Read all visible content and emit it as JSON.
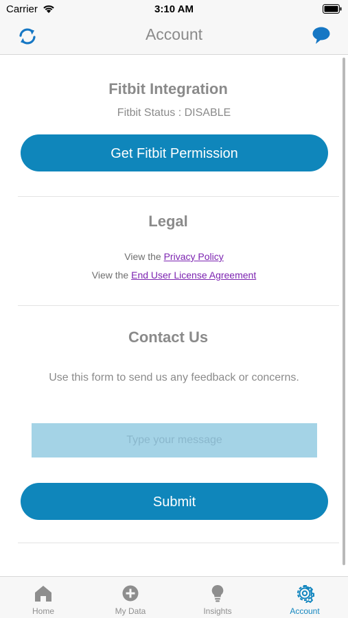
{
  "status_bar": {
    "carrier": "Carrier",
    "time": "3:10 AM"
  },
  "nav": {
    "title": "Account",
    "left_icon": "refresh-icon",
    "right_icon": "chat-bubble-icon"
  },
  "fitbit": {
    "title": "Fitbit Integration",
    "status": "Fitbit Status : DISABLE",
    "button_label": "Get Fitbit Permission"
  },
  "legal": {
    "title": "Legal",
    "line1_prefix": "View the ",
    "privacy_link": "Privacy Policy",
    "line2_prefix": "View the ",
    "eula_link": "End User License Agreement"
  },
  "contact": {
    "title": "Contact Us",
    "description": "Use this form to send  us any feedback or concerns.",
    "placeholder": "Type your message",
    "submit_label": "Submit"
  },
  "tabs": [
    {
      "label": "Home",
      "icon": "home-icon",
      "active": false
    },
    {
      "label": "My Data",
      "icon": "add-circle-icon",
      "active": false
    },
    {
      "label": "Insights",
      "icon": "lightbulb-icon",
      "active": false
    },
    {
      "label": "Account",
      "icon": "gear-icon",
      "active": true
    }
  ],
  "colors": {
    "accent": "#0f86bb",
    "input_bg": "#a4d3e6",
    "link": "#7b22b0",
    "tab_active": "#1386bf",
    "tab_inactive": "#8e8e8e"
  }
}
